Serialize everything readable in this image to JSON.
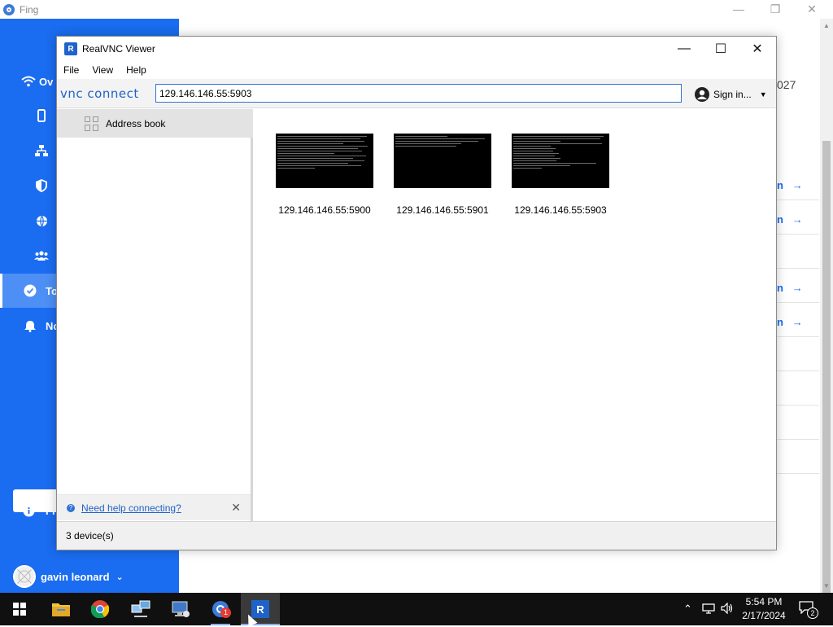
{
  "fing": {
    "title": "Fing",
    "nav": [
      {
        "label": "Ov",
        "icon": "wifi-icon"
      },
      {
        "label": "",
        "icon": "phone-icon"
      },
      {
        "label": "",
        "icon": "network-icon"
      },
      {
        "label": "",
        "icon": "shield-icon"
      },
      {
        "label": "",
        "icon": "globe-icon"
      },
      {
        "label": "",
        "icon": "people-icon"
      },
      {
        "label": "To",
        "icon": "check-circle-icon"
      },
      {
        "label": "No",
        "icon": "bell-icon"
      },
      {
        "label": "Fi",
        "icon": "info-icon"
      }
    ],
    "user_name": "gavin leonard",
    "year_fragment": "027",
    "right_links": [
      "n",
      "n",
      "n",
      "n"
    ],
    "arrow": "→"
  },
  "vnc": {
    "title": "RealVNC Viewer",
    "menu": [
      "File",
      "View",
      "Help"
    ],
    "brand": "vnc connect",
    "address_value": "129.146.146.55:5903",
    "sign_in": "Sign in...",
    "address_book": "Address book",
    "help_link": "Need help connecting?",
    "devices": [
      {
        "label": "129.146.146.55:5900"
      },
      {
        "label": "129.146.146.55:5901"
      },
      {
        "label": "129.146.146.55:5903"
      }
    ],
    "status": "3 device(s)"
  },
  "taskbar": {
    "time": "5:54 PM",
    "date": "2/17/2024",
    "badge_count": "1",
    "notification_count": "2"
  }
}
